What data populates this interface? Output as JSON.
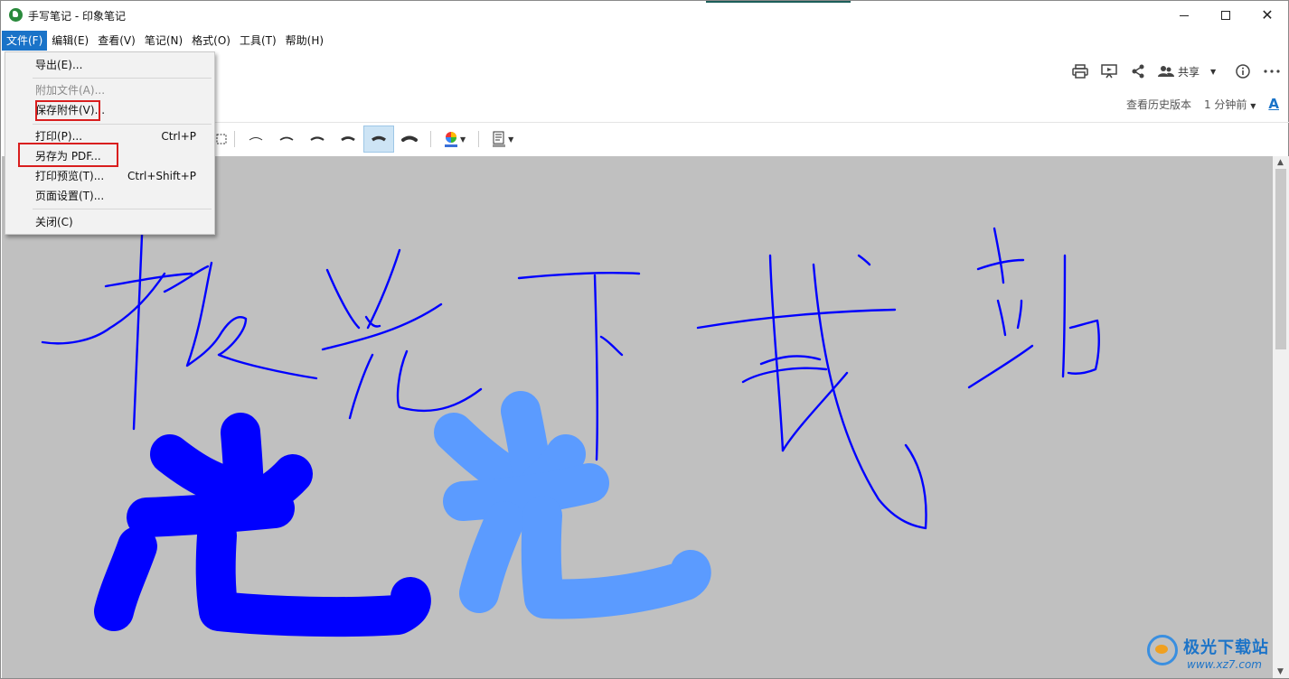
{
  "window": {
    "title": "手写笔记 - 印象笔记",
    "logo_icon": "evernote-elephant-icon"
  },
  "menubar": {
    "items": [
      {
        "label": "文件(F)",
        "active": true
      },
      {
        "label": "编辑(E)"
      },
      {
        "label": "查看(V)"
      },
      {
        "label": "笔记(N)"
      },
      {
        "label": "格式(O)"
      },
      {
        "label": "工具(T)"
      },
      {
        "label": "帮助(H)"
      }
    ]
  },
  "note_header": {
    "share_label": "共享",
    "history_label": "查看历史版本",
    "time_label": "1 分钟前",
    "font_label": "A"
  },
  "file_menu": {
    "export": "导出(E)...",
    "attach": "附加文件(A)...",
    "save_attachment": "保存附件(V)...",
    "print": "打印(P)...",
    "print_shortcut": "Ctrl+P",
    "save_pdf": "另存为 PDF...",
    "print_preview": "打印预览(T)...",
    "print_preview_shortcut": "Ctrl+Shift+P",
    "page_setup": "页面设置(T)...",
    "close": "关闭(C)"
  },
  "ink": {
    "canvas_color": "#c0c0c0",
    "pen_colors": [
      "#0000ff",
      "#5b9bff"
    ],
    "handwriting_text": "极光下载站",
    "large_strokes_text": "光光"
  },
  "watermark": {
    "title": "极光下载站",
    "url": "www.xz7.com"
  },
  "colors": {
    "menu_active": "#1a73c8",
    "highlight_red": "#d91e1e",
    "selected_pen_bg": "#cde4f5"
  }
}
